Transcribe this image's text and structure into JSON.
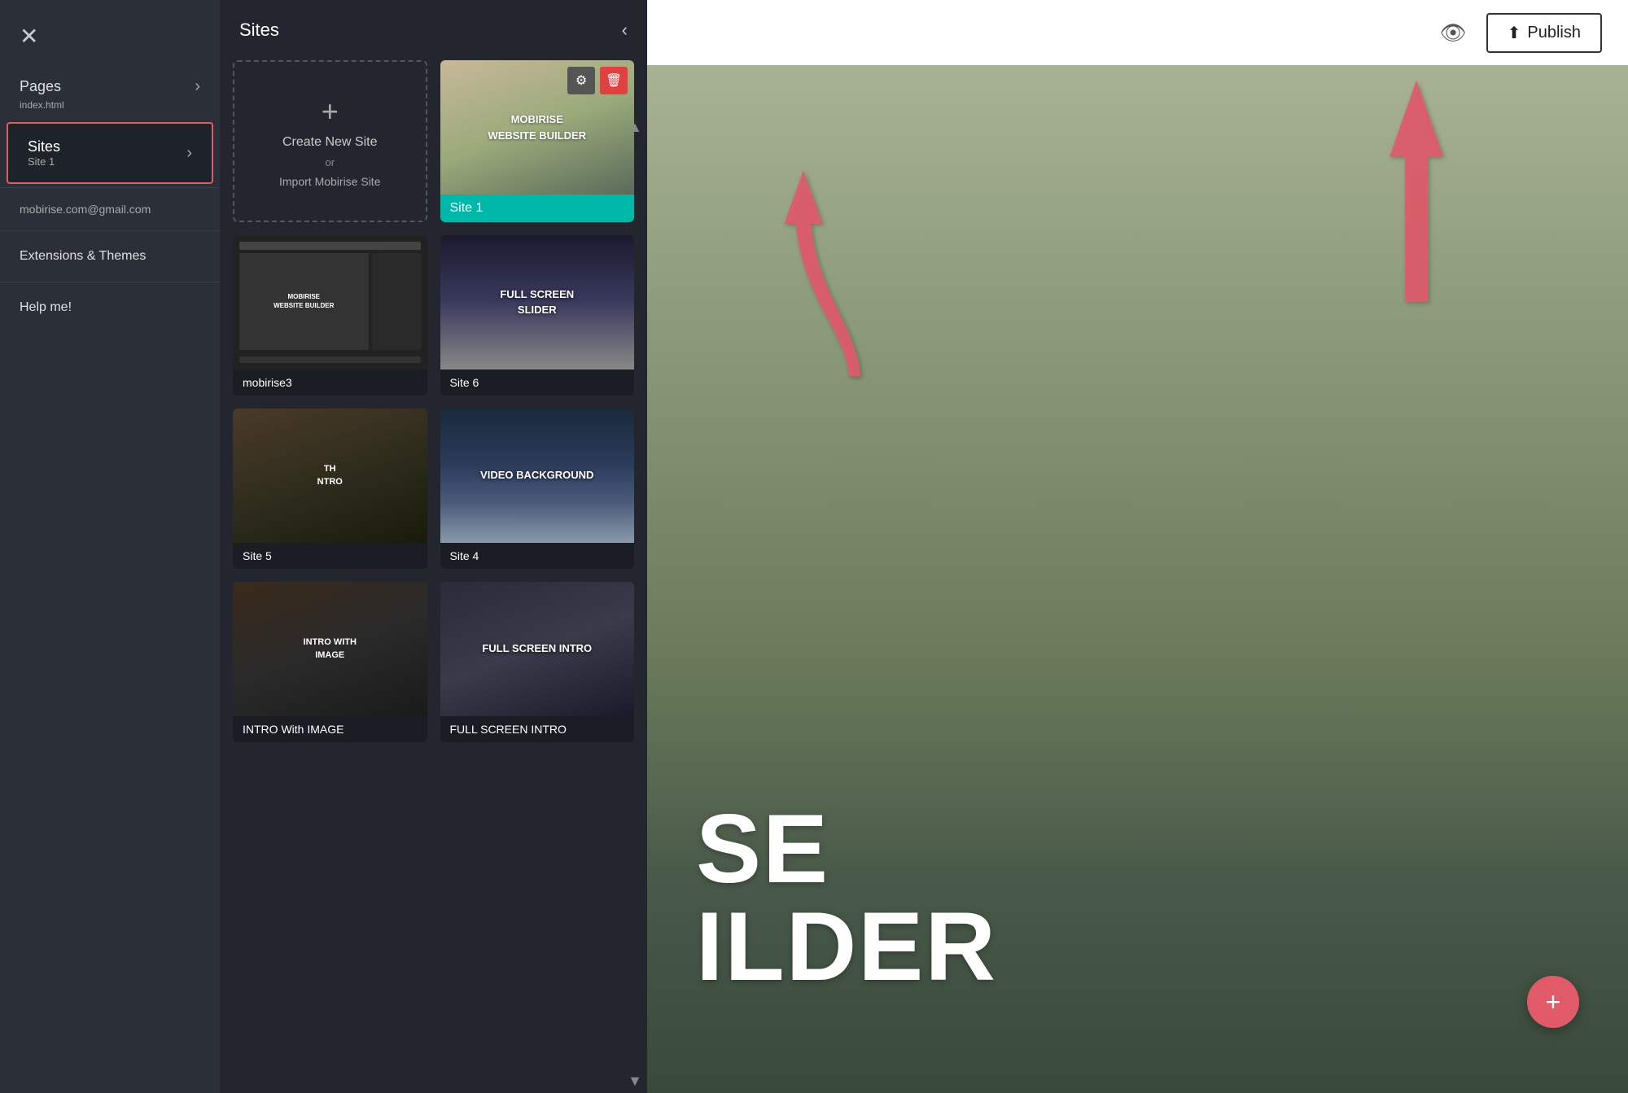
{
  "sidebar": {
    "close_icon": "✕",
    "pages_label": "Pages",
    "pages_sub": "index.html",
    "sites_label": "Sites",
    "sites_sub": "Site 1",
    "email": "mobirise.com@gmail.com",
    "extensions_label": "Extensions & Themes",
    "help_label": "Help me!",
    "chevron": "›"
  },
  "sites_panel": {
    "title": "Sites",
    "close_icon": "‹",
    "create_label": "Create New Site",
    "create_or": "or",
    "create_import": "Import Mobirise Site",
    "plus_icon": "+",
    "scroll_up": "▲",
    "scroll_down": "▼"
  },
  "site_cards": [
    {
      "id": "site1",
      "name": "Site 1",
      "thumb_type": "site1",
      "thumb_text": "MOBIRISE\nWEBSITE BUILDER",
      "has_actions": true
    },
    {
      "id": "mobirise3",
      "name": "mobirise3",
      "thumb_type": "mobirise3",
      "thumb_text": "MOBIRISE\nWEBSITE BUILDER",
      "has_actions": false
    },
    {
      "id": "site6",
      "name": "Site 6",
      "thumb_type": "site6",
      "thumb_text": "FULL SCREEN\nSLIDER",
      "has_actions": false
    },
    {
      "id": "site5",
      "name": "Site 5",
      "thumb_type": "site5",
      "thumb_text": "TH\nNTRO",
      "has_actions": false
    },
    {
      "id": "site4",
      "name": "Site 4",
      "thumb_type": "site4",
      "thumb_text": "VIDEO BACKGROUND",
      "has_actions": false
    },
    {
      "id": "intro-image",
      "name": "INTRO With IMAGE",
      "thumb_type": "intro-image",
      "thumb_text": "INTRO WITH\nIMAGE",
      "has_actions": false
    },
    {
      "id": "fullscreen-intro",
      "name": "FULL SCREEN INTRO",
      "thumb_type": "fullscreen-intro",
      "thumb_text": "FULL SCREEN INTRO",
      "has_actions": false
    }
  ],
  "header": {
    "preview_icon": "👁",
    "publish_icon": "⬆",
    "publish_label": "Publish"
  },
  "main": {
    "big_text_line1": "SE",
    "big_text_line2": "ILDER"
  },
  "fab": {
    "icon": "+"
  }
}
